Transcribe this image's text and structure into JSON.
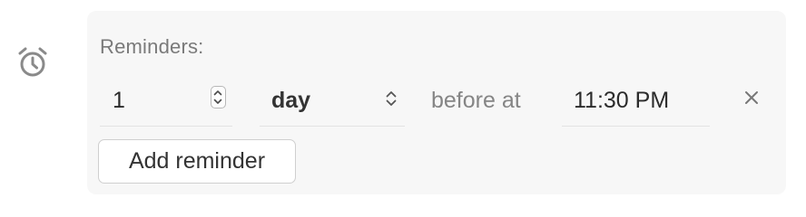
{
  "reminders": {
    "heading": "Reminders:",
    "items": [
      {
        "quantity": "1",
        "unit": "day",
        "relation": "before at",
        "time": "11:30 PM"
      }
    ],
    "add_button_label": "Add reminder"
  },
  "icons": {
    "section": "alarm-clock-icon",
    "stepper": "stepper-icon",
    "unit_select": "chevron-up-down-icon",
    "remove": "close-icon"
  },
  "colors": {
    "panel_background": "#f7f7f7",
    "icon_gray": "#8a8a8a",
    "label_gray": "#7a7a7a",
    "text_dark": "#2b2b2b"
  }
}
